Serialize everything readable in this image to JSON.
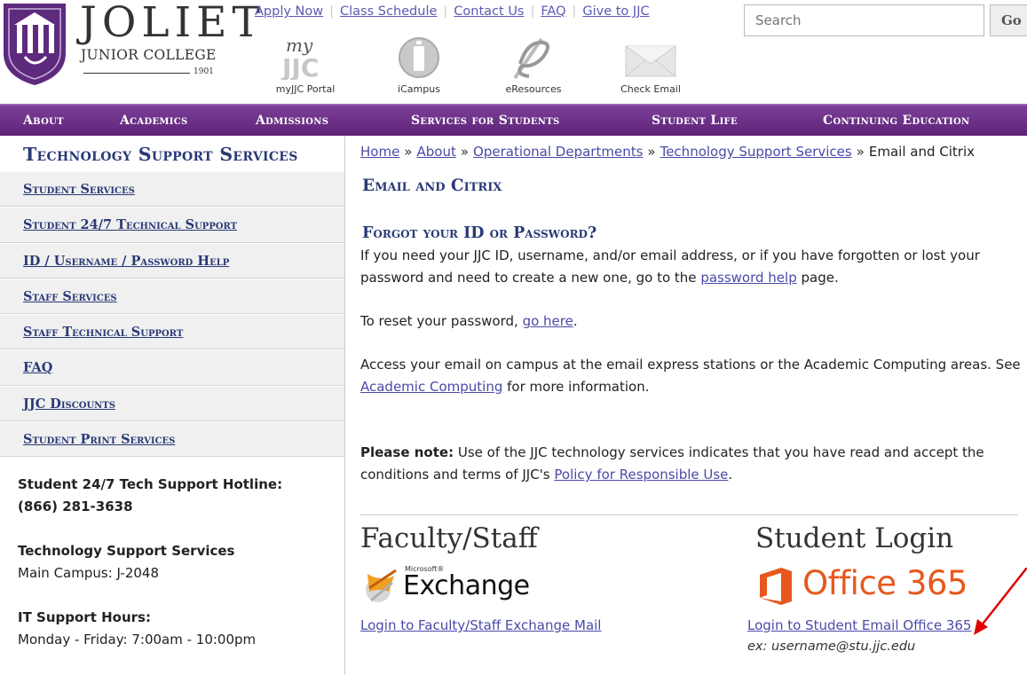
{
  "logo": {
    "name_line1": "JOLIET",
    "name_line2": "JUNIOR COLLEGE",
    "year": "1901"
  },
  "top_links": [
    "Apply Now",
    "Class Schedule",
    "Contact Us",
    "FAQ",
    "Give to JJC"
  ],
  "search": {
    "placeholder": "Search",
    "go_label": "Go"
  },
  "quick_links": [
    {
      "label": "myJJC Portal",
      "icon": "myjjc-logo-icon"
    },
    {
      "label": "iCampus",
      "icon": "icampus-icon"
    },
    {
      "label": "eResources",
      "icon": "eresources-icon"
    },
    {
      "label": "Check Email",
      "icon": "envelope-icon"
    }
  ],
  "nav": [
    "About",
    "Academics",
    "Admissions",
    "Services for Students",
    "Student Life",
    "Continuing Education"
  ],
  "sidebar": {
    "title": "Technology Support Services",
    "items": [
      "Student Services",
      "Student 24/7 Technical Support",
      "ID / Username / Password Help",
      "Staff Services",
      "Staff Technical Support",
      "FAQ",
      "JJC Discounts",
      "Student Print Services"
    ],
    "hotline_label": "Student 24/7 Tech Support Hotline:",
    "hotline_number": "(866) 281-3638",
    "tss_label": "Technology Support Services",
    "tss_location": "Main Campus: J-2048",
    "hours_label": "IT Support Hours:",
    "hours_value": "Monday - Friday: 7:00am - 10:00pm"
  },
  "breadcrumb": {
    "items": [
      "Home",
      "About",
      "Operational Departments",
      "Technology Support Services"
    ],
    "current": "Email and Citrix",
    "separator": "»"
  },
  "main": {
    "title": "Email and Citrix",
    "forgot_heading": "Forgot your ID or Password?",
    "p1_text": "If you need your JJC ID, username, and/or email address, or if you have forgotten or lost your password and need to create a new one, go to the",
    "p1_link": "password help",
    "p1_end": "page.",
    "p2_text": "To reset your password,",
    "p2_link": "go here",
    "p2_end": ".",
    "p3_text": "Access your email on campus at the email express stations or the Academic Computing areas. See",
    "p3_link": "Academic Computing",
    "p3_end": "for more information.",
    "p4_bold": "Please note:",
    "p4_text": "Use of the JJC technology services indicates that you have read and accept the conditions and terms of JJC's",
    "p4_link": "Policy for Responsible Use",
    "p4_end": ".",
    "faculty": {
      "heading": "Faculty/Staff",
      "logo_small": "Microsoft®",
      "logo_word": "Exchange",
      "link": "Login to Faculty/Staff Exchange Mail"
    },
    "student": {
      "heading": "Student Login",
      "logo_word": "Office 365",
      "link": "Login to Student Email Office 365",
      "example": "ex: username@stu.jjc.edu"
    }
  },
  "colors": {
    "purple": "#6a2c85",
    "navy": "#2a3a76",
    "link": "#4a4aa8",
    "office_orange": "#e8571e",
    "arrow_red": "#e00000"
  }
}
